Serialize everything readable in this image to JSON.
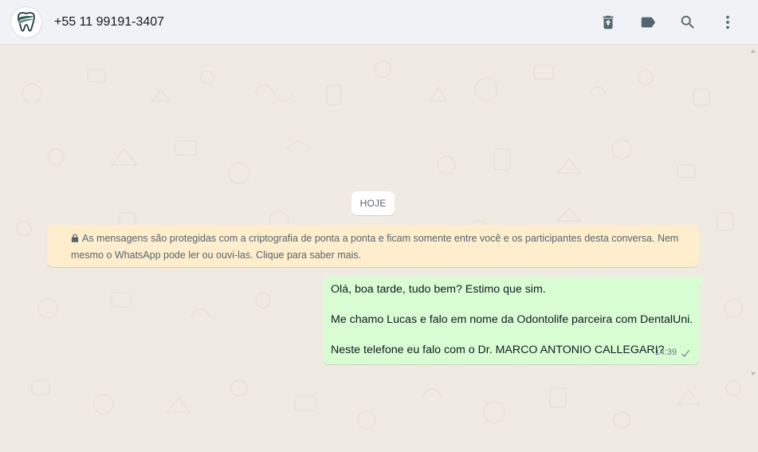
{
  "header": {
    "contact_name": "+55 11 99191-3407",
    "icons": [
      "trash-icon",
      "label-icon",
      "search-icon",
      "menu-icon"
    ]
  },
  "chat": {
    "date_divider": "HOJE",
    "encryption_notice": {
      "line1": "As mensagens são protegidas com a criptografia de ponta a ponta e ficam somente entre você e os participantes desta conversa. Nem",
      "line2": "mesmo o WhatsApp pode ler ou ouvi-las. Clique para saber mais."
    },
    "messages": [
      {
        "direction": "outgoing",
        "lines": [
          "Olá, boa tarde, tudo bem? Estimo que sim.",
          "Me chamo Lucas e falo em nome da Odontolife parceira com DentalUni.",
          "Neste telefone eu falo com o Dr. MARCO ANTONIO CALLEGARI?"
        ],
        "time": "14:39",
        "status": "sent"
      }
    ]
  },
  "colors": {
    "header_bg": "#f0f2f5",
    "chat_bg": "#efeae2",
    "outgoing_bubble": "#d9fdd3",
    "notice_bg": "#ffeecd",
    "icon": "#54656f"
  }
}
